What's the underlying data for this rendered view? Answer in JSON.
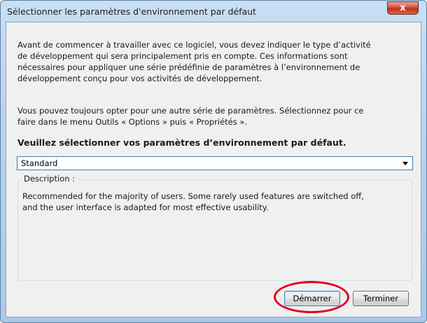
{
  "window": {
    "title": "Sélectionner les paramètres d'environnement par défaut",
    "close_glyph": "x"
  },
  "intro_text": "Avant de commencer à travailler avec ce logiciel, vous devez indiquer le type d’activité\nde développement qui sera principalement pris en compte. Ces informations sont\nnécessaires pour appliquer une série prédéfinie de paramètres à l’environnement de\ndéveloppement conçu pour vos activités de développement.",
  "info_text": "Vous pouvez toujours opter pour une autre série de paramètres. Sélectionnez pour ce\nfaire dans le menu Outils « Options » puis « Propriétés ».",
  "settings_heading": "Veuillez sélectionner vos paramètres d’environnement par défaut.",
  "settings_select": {
    "value": "Standard"
  },
  "description": {
    "label": "Description :",
    "text": "Recommended for the majority of users. Some rarely used features are switched off,\nand the user interface is adapted for most effective usability."
  },
  "buttons": {
    "start_label": "Démarrer",
    "finish_label": "Terminer"
  },
  "colors": {
    "highlight_ring": "#e2001a",
    "close_button": "#c0321a",
    "focus_border": "#3c7fb1"
  },
  "icons": {
    "close": "close-icon",
    "dropdown": "chevron-down-icon"
  }
}
